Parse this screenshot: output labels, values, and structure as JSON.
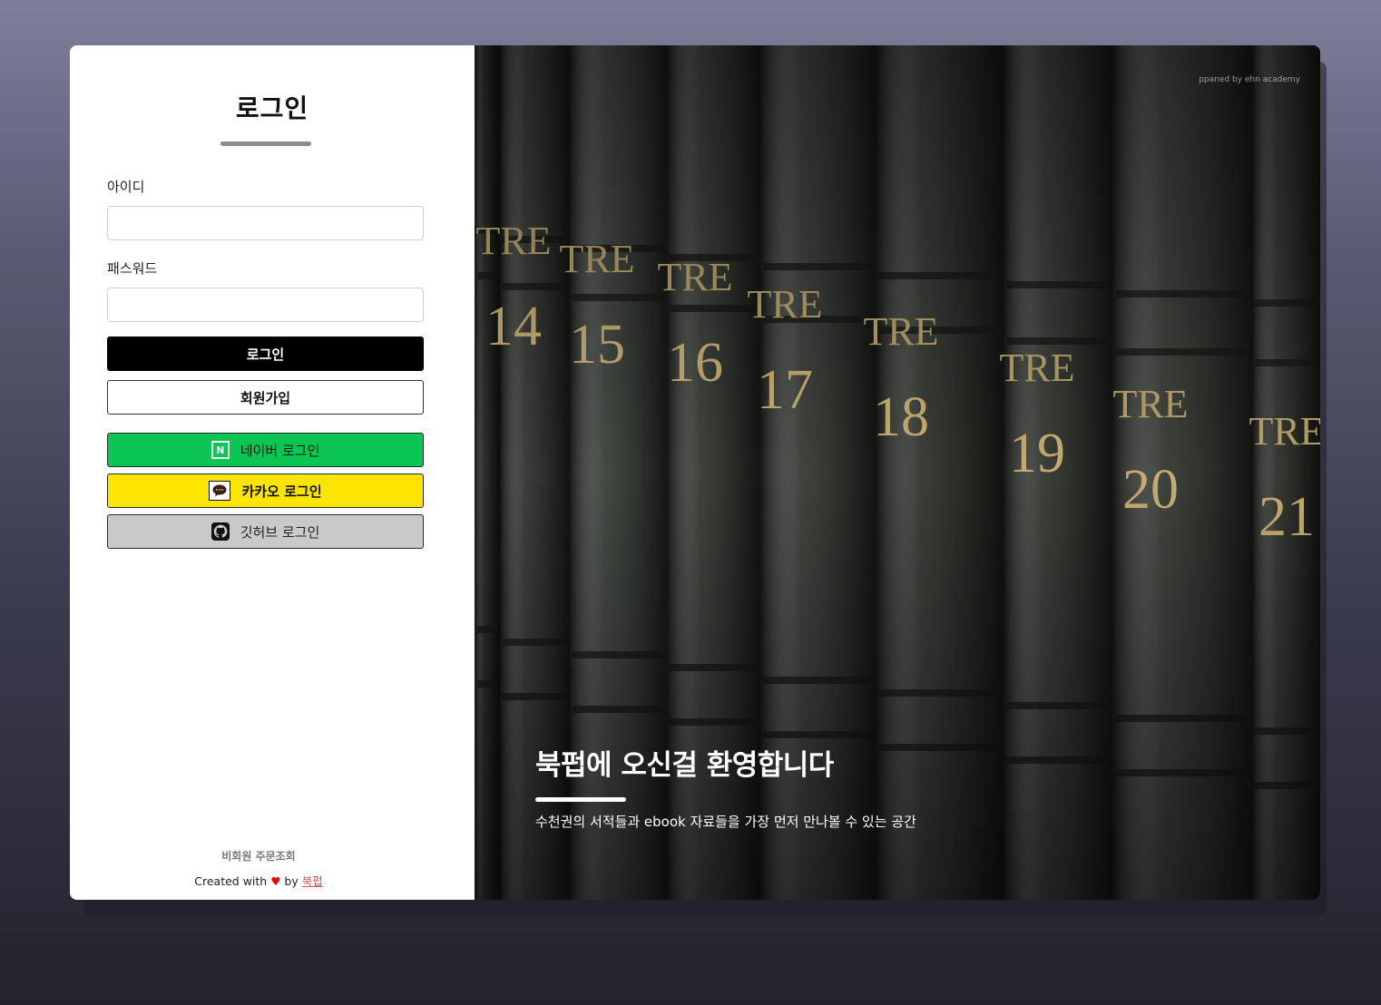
{
  "login": {
    "title": "로그인",
    "id_label": "아이디",
    "id_value": "",
    "password_label": "패스워드",
    "password_value": "",
    "login_button": "로그인",
    "signup_button": "회원가입",
    "naver_button": "네이버 로그인",
    "kakao_button": "카카오 로그인",
    "github_button": "깃허브 로그인"
  },
  "footer": {
    "guest_order": "비회원 주문조회",
    "created_prefix": "Created with",
    "heart": "♥",
    "by": "by",
    "brand": "북펍"
  },
  "hero": {
    "credit": "ppaned by ehn academy",
    "headline": "북펍에 오신걸 환영합니다",
    "subtitle": "수천권의 서적들과 ebook 자료들을 가장 먼저 만나볼 수 있는 공간",
    "volumes": [
      "14",
      "15",
      "16",
      "17",
      "18",
      "19",
      "20",
      "21"
    ],
    "series_label": "TRE"
  },
  "colors": {
    "naver": "#0bc653",
    "kakao": "#fee500",
    "github": "#cbc8c8",
    "primary": "#000000",
    "link": "#d9534f"
  },
  "icons": {
    "naver": "naver-n-icon",
    "kakao": "kakao-talk-icon",
    "github": "github-octocat-icon",
    "heart": "heart-icon"
  }
}
